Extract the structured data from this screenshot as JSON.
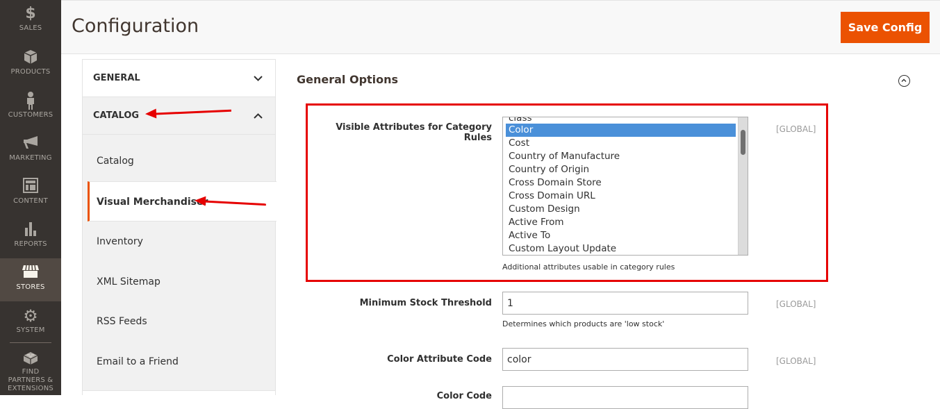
{
  "admin_nav": {
    "items": [
      {
        "label": "SALES",
        "icon": "dollar-icon"
      },
      {
        "label": "PRODUCTS",
        "icon": "box-icon"
      },
      {
        "label": "CUSTOMERS",
        "icon": "person-icon"
      },
      {
        "label": "MARKETING",
        "icon": "megaphone-icon"
      },
      {
        "label": "CONTENT",
        "icon": "layout-icon"
      },
      {
        "label": "REPORTS",
        "icon": "bar-chart-icon"
      },
      {
        "label": "STORES",
        "icon": "store-icon",
        "active": true
      },
      {
        "label": "SYSTEM",
        "icon": "gear-icon"
      },
      {
        "label": "FIND PARTNERS & EXTENSIONS",
        "icon": "lego-block-icon"
      }
    ]
  },
  "header": {
    "title": "Configuration",
    "save_label": "Save Config"
  },
  "tabs": {
    "general": {
      "label": "GENERAL",
      "chevron": "∨"
    },
    "catalog": {
      "label": "CATALOG",
      "chevron": "∧"
    },
    "items": [
      {
        "label": "Catalog"
      },
      {
        "label": "Visual Merchandiser",
        "active": true
      },
      {
        "label": "Inventory"
      },
      {
        "label": "XML Sitemap"
      },
      {
        "label": "RSS Feeds"
      },
      {
        "label": "Email to a Friend"
      }
    ]
  },
  "section": {
    "title": "General Options",
    "fields": {
      "visible_attributes": {
        "label": "Visible Attributes for Category Rules",
        "options": [
          "class",
          "Color",
          "Cost",
          "Country of Manufacture",
          "Country of Origin",
          "Cross Domain Store",
          "Cross Domain URL",
          "Custom Design",
          "Active From",
          "Active To",
          "Custom Layout Update"
        ],
        "selected": "Color",
        "note": "Additional attributes usable in category rules",
        "scope": "[GLOBAL]"
      },
      "min_stock": {
        "label": "Minimum Stock Threshold",
        "value": "1",
        "note": "Determines which products are 'low stock'",
        "scope": "[GLOBAL]"
      },
      "color_attr": {
        "label": "Color Attribute Code",
        "value": "color",
        "scope": "[GLOBAL]"
      },
      "color_code": {
        "label": "Color Code",
        "value": ""
      }
    }
  },
  "annotation_color": "#e60000",
  "accent_color": "#eb5202"
}
